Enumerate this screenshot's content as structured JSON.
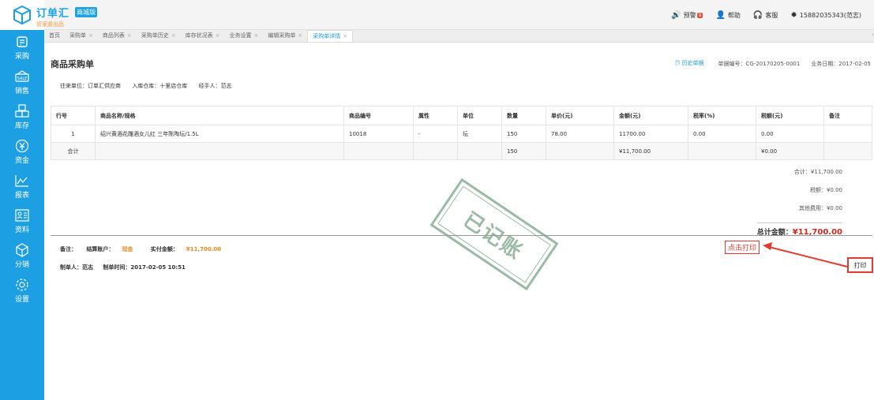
{
  "header": {
    "brand_name": "订单汇",
    "brand_tag": "商城版",
    "brand_sub": "管家婆出品",
    "alerts_label": "预警",
    "alerts_count": "9",
    "help_label": "帮助",
    "service_label": "客服",
    "user_label": "15882035343(范志)"
  },
  "sidebar": {
    "items": [
      {
        "label": "采购",
        "icon": "cart-icon"
      },
      {
        "label": "销售",
        "icon": "sale-icon"
      },
      {
        "label": "库存",
        "icon": "boxes-icon"
      },
      {
        "label": "资金",
        "icon": "money-icon"
      },
      {
        "label": "报表",
        "icon": "chart-icon"
      },
      {
        "label": "资料",
        "icon": "profile-icon"
      },
      {
        "label": "分销",
        "icon": "cube-icon"
      },
      {
        "label": "设置",
        "icon": "gear-icon"
      }
    ]
  },
  "tabs": [
    {
      "label": "首页",
      "closable": false
    },
    {
      "label": "采购单",
      "closable": true
    },
    {
      "label": "商品列表",
      "closable": true
    },
    {
      "label": "采购单历史",
      "closable": true
    },
    {
      "label": "库存状况表",
      "closable": true
    },
    {
      "label": "业务设置",
      "closable": true
    },
    {
      "label": "编辑采购单",
      "closable": true
    },
    {
      "label": "采购单详情",
      "closable": true,
      "active": true
    }
  ],
  "document": {
    "title": "商品采购单",
    "history_link": "历史单据",
    "doc_no_label": "单据编号：CG-20170205-0001",
    "biz_date_label": "业务日期：2017-02-05",
    "supplier": "往来单位：订单汇供应商",
    "warehouse": "入库仓库：十里店仓库",
    "handler": "经手人：范志"
  },
  "table": {
    "headers": [
      "行号",
      "商品名称/规格",
      "商品编号",
      "属性",
      "单位",
      "数量",
      "单价(元)",
      "金额(元)",
      "税率(%)",
      "税额(元)",
      "备注"
    ],
    "rows": [
      [
        "1",
        "绍兴黄酒花雕酒女儿红 三年陈陶坛/1.5L",
        "10018",
        "-",
        "坛",
        "150",
        "78.00",
        "11700.00",
        "0.00",
        "0.00",
        ""
      ]
    ],
    "total_row": {
      "label": "合计",
      "qty": "150",
      "amount": "¥11,700.00",
      "tax": "¥0.00"
    }
  },
  "summary": {
    "subtotal": "合计：¥11,700.00",
    "tax": "税额：¥0.00",
    "other_fee": "其他费用：¥0.00",
    "grand_label": "总计金额：",
    "grand_value": "¥11,700.00"
  },
  "footer": {
    "remark_label": "备注：",
    "account_label": "结算账户：",
    "account_value": "现金",
    "paid_label": "实付金额：",
    "paid_value": "¥11,700.00",
    "maker": "制单人：范志",
    "made_time": "制单时间：2017-02-05 10:51"
  },
  "stamp_text": "已记账",
  "callout_text": "点击打印",
  "print_button": "打印",
  "colors": {
    "sidebar": "#1d9fe4",
    "accent_red": "#e23a2e",
    "orange": "#f08a24",
    "stamp": "#7aa489"
  }
}
